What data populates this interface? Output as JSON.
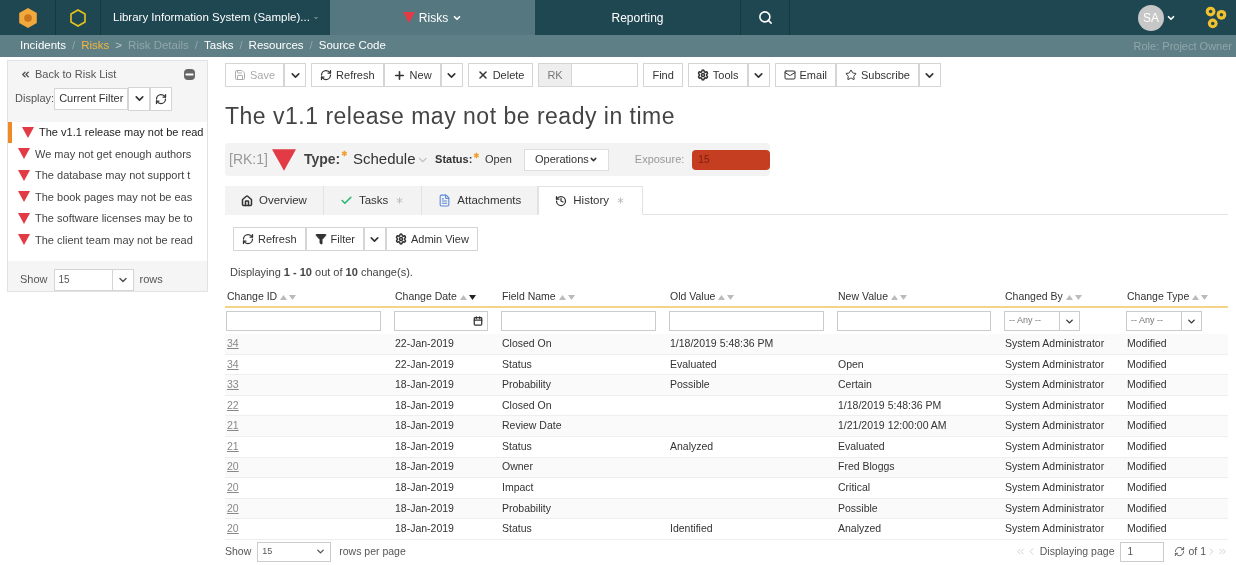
{
  "top_nav": {
    "project": "Library Information System (Sample)...",
    "tabs": [
      {
        "label": "Risks",
        "selected": true
      },
      {
        "label": "Reporting",
        "selected": false
      }
    ],
    "avatar": "SA"
  },
  "breadcrumb": {
    "items": [
      {
        "label": "Incidents",
        "kind": "link",
        "separator": "/"
      },
      {
        "label": "Risks",
        "kind": "current",
        "separator": ">"
      },
      {
        "label": "Risk Details",
        "kind": "disabled",
        "separator": "/"
      },
      {
        "label": "Tasks",
        "kind": "link",
        "separator": "/"
      },
      {
        "label": "Resources",
        "kind": "link",
        "separator": "/"
      },
      {
        "label": "Source Code",
        "kind": "link"
      }
    ],
    "role": "Role: Project Owner"
  },
  "sidebar": {
    "back_link": "Back to Risk List",
    "display_label": "Display:",
    "filter": "Current Filter",
    "items": [
      {
        "label": "The v1.1 release may not be read",
        "selected": true
      },
      {
        "label": "We may not get enough authors",
        "selected": false
      },
      {
        "label": "The database may not support t",
        "selected": false
      },
      {
        "label": "The book pages may not be eas",
        "selected": false
      },
      {
        "label": "The software licenses may be to",
        "selected": false
      },
      {
        "label": "The client team may not be read",
        "selected": false
      }
    ],
    "show_label": "Show",
    "rows_value": "15",
    "rows_label": "rows"
  },
  "toolbar": {
    "save": {
      "label": "Save",
      "disabled": true
    },
    "refresh": "Refresh",
    "new": "New",
    "delete": "Delete",
    "find_prefix": "RK",
    "find": "Find",
    "tools": "Tools",
    "email": "Email",
    "subscribe": "Subscribe"
  },
  "title": "The v1.1 release may not be ready in time",
  "summary": {
    "id": "[RK:1]",
    "type_label": "Type:",
    "type_value": "Schedule",
    "status_label": "Status:",
    "status_value": "Open",
    "operations": "Operations",
    "exposure_label": "Exposure:",
    "exposure_value": "15"
  },
  "tabs": [
    {
      "label": "Overview",
      "selected": false,
      "has_items": false
    },
    {
      "label": "Tasks",
      "selected": false,
      "has_items": true
    },
    {
      "label": "Attachments",
      "selected": false,
      "has_items": false
    },
    {
      "label": "History",
      "selected": true,
      "has_items": true
    }
  ],
  "history_toolbar": {
    "refresh": "Refresh",
    "filter": "Filter",
    "admin_view": "Admin View"
  },
  "count": "Displaying **1 - 10** out of **10** change(s).",
  "table": {
    "columns": [
      {
        "label": "Change ID",
        "sorted": false,
        "kind": "text"
      },
      {
        "label": "Change Date",
        "sorted": true,
        "kind": "date"
      },
      {
        "label": "Field Name",
        "sorted": false,
        "kind": "text"
      },
      {
        "label": "Old Value",
        "sorted": false,
        "kind": "text"
      },
      {
        "label": "New Value",
        "sorted": false,
        "kind": "text"
      },
      {
        "label": "Changed By",
        "sorted": false,
        "kind": "select",
        "filter_value": "-- Any --"
      },
      {
        "label": "Change Type",
        "sorted": false,
        "kind": "select",
        "filter_value": "-- Any --"
      }
    ],
    "rows": [
      [
        "34",
        "22-Jan-2019",
        "Closed On",
        "1/18/2019 5:48:36 PM",
        "",
        "System Administrator",
        "Modified"
      ],
      [
        "34",
        "22-Jan-2019",
        "Status",
        "Evaluated",
        "Open",
        "System Administrator",
        "Modified"
      ],
      [
        "33",
        "18-Jan-2019",
        "Probability",
        "Possible",
        "Certain",
        "System Administrator",
        "Modified"
      ],
      [
        "22",
        "18-Jan-2019",
        "Closed On",
        "",
        "1/18/2019 5:48:36 PM",
        "System Administrator",
        "Modified"
      ],
      [
        "21",
        "18-Jan-2019",
        "Review Date",
        "",
        "1/21/2019 12:00:00 AM",
        "System Administrator",
        "Modified"
      ],
      [
        "21",
        "18-Jan-2019",
        "Status",
        "Analyzed",
        "Evaluated",
        "System Administrator",
        "Modified"
      ],
      [
        "20",
        "18-Jan-2019",
        "Owner",
        "",
        "Fred Bloggs",
        "System Administrator",
        "Modified"
      ],
      [
        "20",
        "18-Jan-2019",
        "Impact",
        "",
        "Critical",
        "System Administrator",
        "Modified"
      ],
      [
        "20",
        "18-Jan-2019",
        "Probability",
        "",
        "Possible",
        "System Administrator",
        "Modified"
      ],
      [
        "20",
        "18-Jan-2019",
        "Status",
        "Identified",
        "Analyzed",
        "System Administrator",
        "Modified"
      ]
    ]
  },
  "pagination": {
    "show_label": "Show",
    "rows_value": "15",
    "rows_label": "rows per page",
    "page_label": "Displaying page",
    "page_value": "1",
    "page_total": "of 1"
  }
}
